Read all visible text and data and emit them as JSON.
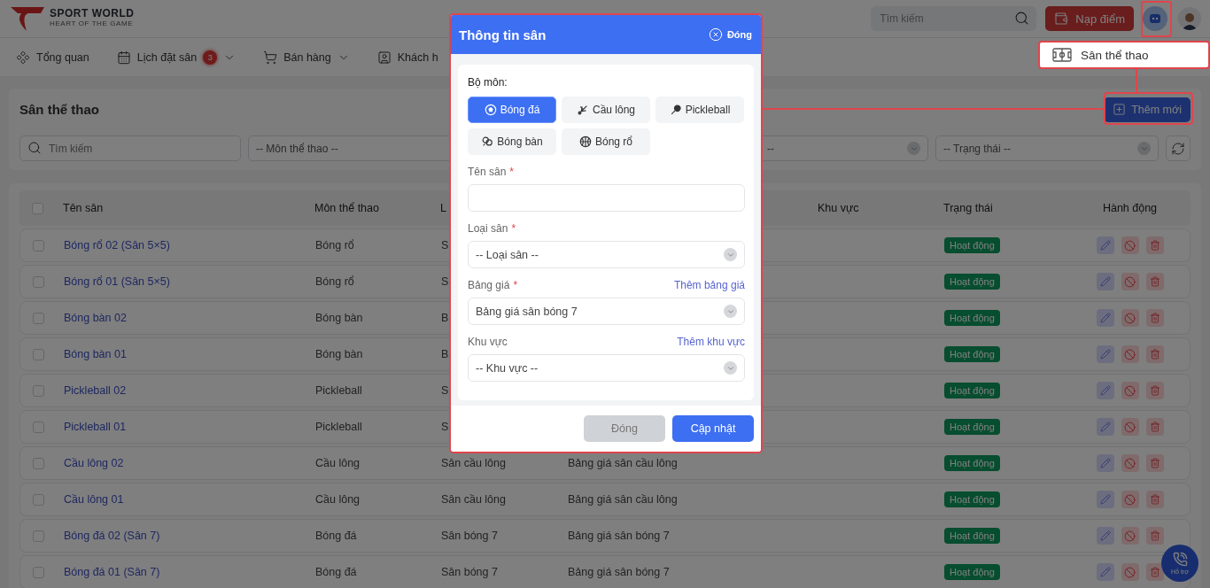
{
  "header": {
    "logo": {
      "title": "SPORT WORLD",
      "tagline": "HEART OF THE GAME"
    },
    "search": {
      "placeholder": "Tìm kiếm"
    },
    "topup_button": "Nạp điểm"
  },
  "nav": [
    {
      "label": "Tổng quan",
      "kind": "overview",
      "dropdown": false
    },
    {
      "label": "Lịch đặt sân",
      "kind": "calendar",
      "badge": "3",
      "dropdown": true
    },
    {
      "label": "Bán hàng",
      "kind": "cart",
      "dropdown": true
    },
    {
      "label": "Khách h",
      "kind": "customer",
      "dropdown": false
    }
  ],
  "tooltip": {
    "label": "Sân thể thao"
  },
  "page": {
    "title": "Sân thể thao",
    "add_button": "Thêm mới",
    "search": {
      "placeholder": "Tìm kiếm"
    },
    "filters": [
      {
        "placeholder": "-- Môn thể thao --",
        "arrow": false
      },
      {
        "placeholder": "--",
        "arrow": true
      },
      {
        "placeholder": "-- Trạng thái --",
        "arrow": true
      }
    ]
  },
  "table": {
    "select_all_checked": false,
    "columns": [
      "Tên sân",
      "Môn thể thao",
      "L",
      "Khu vực",
      "Trạng thái",
      "Hành động"
    ],
    "rows": [
      {
        "name": "Bóng rổ 02 (Sân 5×5)",
        "sport": "Bóng rổ",
        "court_type": "S",
        "status": "Hoạt động",
        "checked": false
      },
      {
        "name": "Bóng rổ 01 (Sân 5×5)",
        "sport": "Bóng rổ",
        "court_type": "S",
        "status": "Hoạt động",
        "checked": false
      },
      {
        "name": "Bóng bàn 02",
        "sport": "Bóng bàn",
        "court_type": "B",
        "status": "Hoạt động",
        "checked": false
      },
      {
        "name": "Bóng bàn 01",
        "sport": "Bóng bàn",
        "court_type": "B",
        "status": "Hoạt động",
        "checked": false
      },
      {
        "name": "Pickleball 02",
        "sport": "Pickleball",
        "court_type": "S",
        "status": "Hoạt động",
        "checked": false
      },
      {
        "name": "Pickleball 01",
        "sport": "Pickleball",
        "court_type": "S",
        "status": "Hoạt động",
        "checked": false
      },
      {
        "name": "Cầu lông 02",
        "sport": "Cầu lông",
        "court_type": "Sân cầu lông",
        "price_list": "Bảng giá sân cầu lông",
        "status": "Hoạt động",
        "checked": false
      },
      {
        "name": "Cầu lông 01",
        "sport": "Cầu lông",
        "court_type": "Sân cầu lông",
        "price_list": "Bảng giá sân cầu lông",
        "status": "Hoạt động",
        "checked": false
      },
      {
        "name": "Bóng đá 02 (Sân 7)",
        "sport": "Bóng đá",
        "court_type": "Sân bóng 7",
        "price_list": "Bảng giá sân bóng 7",
        "status": "Hoạt động",
        "checked": false
      },
      {
        "name": "Bóng đá 01 (Sân 7)",
        "sport": "Bóng đá",
        "court_type": "Sân bóng 7",
        "price_list": "Bảng giá sân bóng 7",
        "status": "Hoạt động",
        "checked": false
      }
    ]
  },
  "modal": {
    "title": "Thông tin sân",
    "close_label": "Đóng",
    "sport_label": "Bộ môn:",
    "sports": [
      {
        "label": "Bóng đá",
        "kind": "soccer",
        "selected": true
      },
      {
        "label": "Cầu lông",
        "kind": "badminton",
        "selected": false
      },
      {
        "label": "Pickleball",
        "kind": "pickleball",
        "selected": false
      },
      {
        "label": "Bóng bàn",
        "kind": "pingpong",
        "selected": false
      },
      {
        "label": "Bóng rổ",
        "kind": "basketball",
        "selected": false
      }
    ],
    "fields": [
      {
        "label": "Tên sân",
        "mark": "*",
        "kind": "text"
      },
      {
        "label": "Loại sân",
        "mark": "*",
        "kind": "select",
        "placeholder": "-- Loại sân --"
      },
      {
        "label": "Bảng giá",
        "mark": "*",
        "kind": "select",
        "value": "Bảng giá sân bóng 7",
        "link": "Thêm bảng giá"
      },
      {
        "label": "Khu vực",
        "kind": "select",
        "placeholder": "-- Khu vực --",
        "link": "Thêm khu vực"
      }
    ],
    "buttons": [
      {
        "label": "Đóng",
        "kind": "secondary"
      },
      {
        "label": "Cập nhật",
        "kind": "primary"
      }
    ]
  },
  "help_button": "Hỗ trợ"
}
